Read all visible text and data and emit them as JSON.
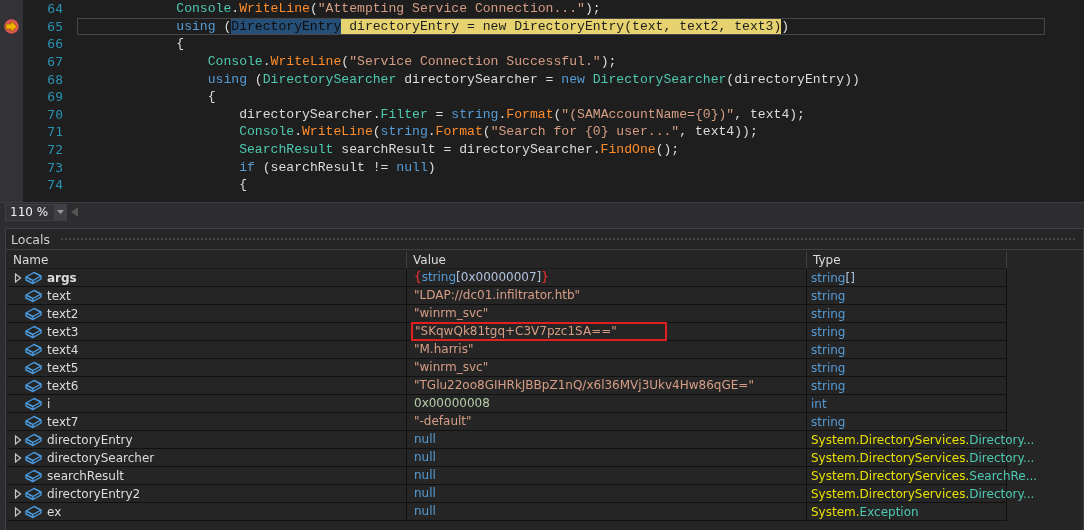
{
  "editor": {
    "lines": [
      {
        "number": "64",
        "current": false,
        "tokens": [
          {
            "t": "            Console",
            "kind": "type"
          },
          {
            "t": ".",
            "kind": "plain"
          },
          {
            "t": "WriteLine",
            "kind": "method"
          },
          {
            "t": "(",
            "kind": "plain"
          },
          {
            "t": "\"Attempting Service Connection...\"",
            "kind": "string"
          },
          {
            "t": ");",
            "kind": "plain"
          }
        ]
      },
      {
        "number": "65",
        "current": true,
        "tokens": [
          {
            "t": "            using",
            "kind": "keyword"
          },
          {
            "t": " (",
            "kind": "plain"
          },
          {
            "t": "DirectoryEntry",
            "kind": "selection"
          },
          {
            "t": " directoryEntry = new DirectoryEntry(text, text2, text3)",
            "kind": "statement"
          },
          {
            "t": ")",
            "kind": "plain"
          }
        ]
      },
      {
        "number": "66",
        "current": false,
        "tokens": [
          {
            "t": "            {",
            "kind": "plain"
          }
        ]
      },
      {
        "number": "67",
        "current": false,
        "tokens": [
          {
            "t": "                Console",
            "kind": "type"
          },
          {
            "t": ".",
            "kind": "plain"
          },
          {
            "t": "WriteLine",
            "kind": "method"
          },
          {
            "t": "(",
            "kind": "plain"
          },
          {
            "t": "\"Service Connection Successful.\"",
            "kind": "string"
          },
          {
            "t": ");",
            "kind": "plain"
          }
        ]
      },
      {
        "number": "68",
        "current": false,
        "tokens": [
          {
            "t": "                using",
            "kind": "keyword"
          },
          {
            "t": " (",
            "kind": "plain"
          },
          {
            "t": "DirectorySearcher",
            "kind": "type"
          },
          {
            "t": " directorySearcher = ",
            "kind": "plain"
          },
          {
            "t": "new",
            "kind": "keyword"
          },
          {
            "t": " DirectorySearcher",
            "kind": "type"
          },
          {
            "t": "(directoryEntry))",
            "kind": "plain"
          }
        ]
      },
      {
        "number": "69",
        "current": false,
        "tokens": [
          {
            "t": "                {",
            "kind": "plain"
          }
        ]
      },
      {
        "number": "70",
        "current": false,
        "tokens": [
          {
            "t": "                    directorySearcher.",
            "kind": "plain"
          },
          {
            "t": "Filter",
            "kind": "property"
          },
          {
            "t": " = ",
            "kind": "plain"
          },
          {
            "t": "string",
            "kind": "keyword"
          },
          {
            "t": ".",
            "kind": "plain"
          },
          {
            "t": "Format",
            "kind": "method"
          },
          {
            "t": "(",
            "kind": "plain"
          },
          {
            "t": "\"(SAMAccountName={0})\"",
            "kind": "string"
          },
          {
            "t": ", text4);",
            "kind": "plain"
          }
        ]
      },
      {
        "number": "71",
        "current": false,
        "tokens": [
          {
            "t": "                    Console",
            "kind": "type"
          },
          {
            "t": ".",
            "kind": "plain"
          },
          {
            "t": "WriteLine",
            "kind": "method"
          },
          {
            "t": "(",
            "kind": "plain"
          },
          {
            "t": "string",
            "kind": "keyword"
          },
          {
            "t": ".",
            "kind": "plain"
          },
          {
            "t": "Format",
            "kind": "method"
          },
          {
            "t": "(",
            "kind": "plain"
          },
          {
            "t": "\"Search for {0} user...\"",
            "kind": "string"
          },
          {
            "t": ", text4));",
            "kind": "plain"
          }
        ]
      },
      {
        "number": "72",
        "current": false,
        "tokens": [
          {
            "t": "                    SearchResult",
            "kind": "type"
          },
          {
            "t": " searchResult = directorySearcher.",
            "kind": "plain"
          },
          {
            "t": "FindOne",
            "kind": "method"
          },
          {
            "t": "();",
            "kind": "plain"
          }
        ]
      },
      {
        "number": "73",
        "current": false,
        "tokens": [
          {
            "t": "                    if",
            "kind": "keyword"
          },
          {
            "t": " (searchResult != ",
            "kind": "plain"
          },
          {
            "t": "null",
            "kind": "keyword"
          },
          {
            "t": ")",
            "kind": "plain"
          }
        ]
      },
      {
        "number": "74",
        "current": false,
        "tokens": [
          {
            "t": "                    {",
            "kind": "plain"
          }
        ]
      }
    ]
  },
  "zoom": {
    "value": "110 %"
  },
  "locals": {
    "title": "Locals",
    "columns": [
      "Name",
      "Value",
      "Type"
    ],
    "rows": [
      {
        "name": "args",
        "expandable": true,
        "bold": true,
        "highlighted": false,
        "value": [
          {
            "t": "{",
            "kind": "brace"
          },
          {
            "t": "string",
            "kind": "keyword"
          },
          {
            "t": "[0x00000007]",
            "kind": "plain"
          },
          {
            "t": "}",
            "kind": "brace"
          }
        ],
        "type": [
          {
            "t": "string",
            "kind": "keyword"
          },
          {
            "t": "[]",
            "kind": "plain"
          }
        ]
      },
      {
        "name": "text",
        "expandable": false,
        "bold": false,
        "highlighted": false,
        "value": [
          {
            "t": "\"LDAP://dc01.infiltrator.htb\"",
            "kind": "string"
          }
        ],
        "type": [
          {
            "t": "string",
            "kind": "keyword"
          }
        ]
      },
      {
        "name": "text2",
        "expandable": false,
        "bold": false,
        "highlighted": false,
        "value": [
          {
            "t": "\"winrm_svc\"",
            "kind": "string"
          }
        ],
        "type": [
          {
            "t": "string",
            "kind": "keyword"
          }
        ]
      },
      {
        "name": "text3",
        "expandable": false,
        "bold": false,
        "highlighted": true,
        "value": [
          {
            "t": "\"SKqwQk81tgq+C3V7pzc1SA==\"",
            "kind": "string"
          }
        ],
        "type": [
          {
            "t": "string",
            "kind": "keyword"
          }
        ]
      },
      {
        "name": "text4",
        "expandable": false,
        "bold": false,
        "highlighted": false,
        "value": [
          {
            "t": "\"M.harris\"",
            "kind": "string"
          }
        ],
        "type": [
          {
            "t": "string",
            "kind": "keyword"
          }
        ]
      },
      {
        "name": "text5",
        "expandable": false,
        "bold": false,
        "highlighted": false,
        "value": [
          {
            "t": "\"winrm_svc\"",
            "kind": "string"
          }
        ],
        "type": [
          {
            "t": "string",
            "kind": "keyword"
          }
        ]
      },
      {
        "name": "text6",
        "expandable": false,
        "bold": false,
        "highlighted": false,
        "value": [
          {
            "t": "\"TGlu22oo8GIHRkJBBpZ1nQ/x6l36MVj3Ukv4Hw86qGE=\"",
            "kind": "string"
          }
        ],
        "type": [
          {
            "t": "string",
            "kind": "keyword"
          }
        ]
      },
      {
        "name": "i",
        "expandable": false,
        "bold": false,
        "highlighted": false,
        "value": [
          {
            "t": "0x00000008",
            "kind": "number"
          }
        ],
        "type": [
          {
            "t": "int",
            "kind": "keyword"
          }
        ]
      },
      {
        "name": "text7",
        "expandable": false,
        "bold": false,
        "highlighted": false,
        "value": [
          {
            "t": "\"-default\"",
            "kind": "string"
          }
        ],
        "type": [
          {
            "t": "string",
            "kind": "keyword"
          }
        ]
      },
      {
        "name": "directoryEntry",
        "expandable": true,
        "bold": false,
        "highlighted": false,
        "value": [
          {
            "t": "null",
            "kind": "keyword"
          }
        ],
        "type": [
          {
            "t": "System.DirectoryServices.",
            "kind": "namespace"
          },
          {
            "t": "Directory...",
            "kind": "type"
          }
        ]
      },
      {
        "name": "directorySearcher",
        "expandable": true,
        "bold": false,
        "highlighted": false,
        "value": [
          {
            "t": "null",
            "kind": "keyword"
          }
        ],
        "type": [
          {
            "t": "System.DirectoryServices.",
            "kind": "namespace"
          },
          {
            "t": "Directory...",
            "kind": "type"
          }
        ]
      },
      {
        "name": "searchResult",
        "expandable": false,
        "bold": false,
        "highlighted": false,
        "value": [
          {
            "t": "null",
            "kind": "keyword"
          }
        ],
        "type": [
          {
            "t": "System.DirectoryServices.",
            "kind": "namespace"
          },
          {
            "t": "SearchRe...",
            "kind": "type"
          }
        ]
      },
      {
        "name": "directoryEntry2",
        "expandable": true,
        "bold": false,
        "highlighted": false,
        "value": [
          {
            "t": "null",
            "kind": "keyword"
          }
        ],
        "type": [
          {
            "t": "System.DirectoryServices.",
            "kind": "namespace"
          },
          {
            "t": "Directory...",
            "kind": "type"
          }
        ]
      },
      {
        "name": "ex",
        "expandable": true,
        "bold": false,
        "highlighted": false,
        "value": [
          {
            "t": "null",
            "kind": "keyword"
          }
        ],
        "type": [
          {
            "t": "System.",
            "kind": "namespace"
          },
          {
            "t": "Exception",
            "kind": "type"
          }
        ]
      }
    ]
  }
}
